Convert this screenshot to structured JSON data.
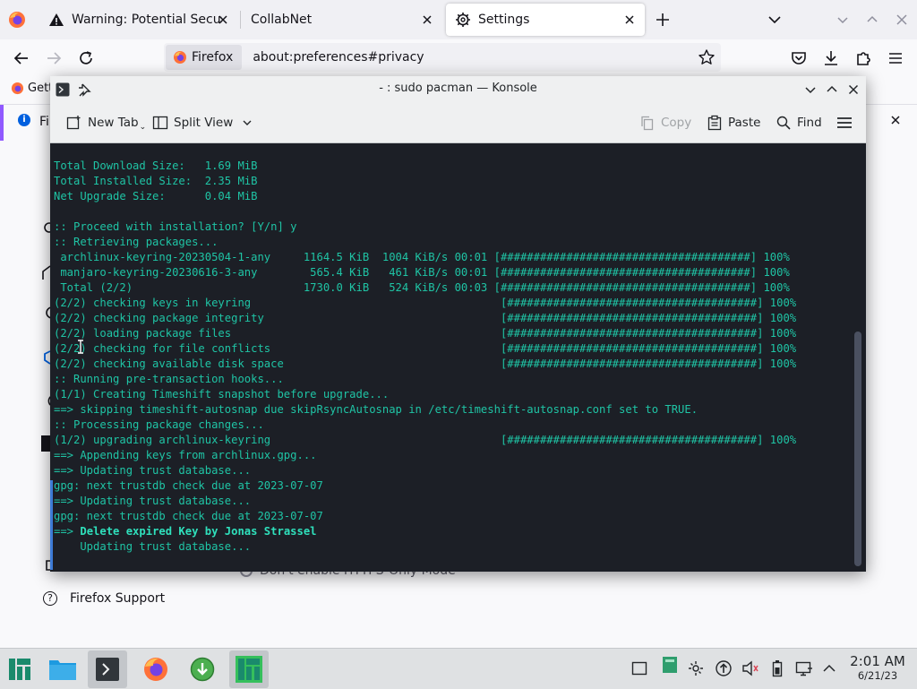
{
  "browser": {
    "tabs": [
      {
        "title": "Warning: Potential Security Risk Ahead",
        "icon": "warning-icon",
        "active": false
      },
      {
        "title": "CollabNet",
        "icon": "",
        "active": false
      },
      {
        "title": "Settings",
        "icon": "gear-icon",
        "active": true
      }
    ],
    "identity_label": "Firefox",
    "url": "about:preferences#privacy",
    "bookmark_label": "Getti",
    "notification_text": "Fi"
  },
  "page": {
    "https_option": "Don't enable HTTPS-Only Mode",
    "support_link": "Firefox Support"
  },
  "konsole": {
    "title": "- : sudo pacman — Konsole",
    "toolbar": {
      "new_tab": "New Tab",
      "split_view": "Split View",
      "copy": "Copy",
      "paste": "Paste",
      "find": "Find"
    },
    "terminal_lines": [
      {
        "text": "Total Download Size:   1.69 MiB"
      },
      {
        "text": "Total Installed Size:  2.35 MiB"
      },
      {
        "text": "Net Upgrade Size:      0.04 MiB"
      },
      {
        "text": ""
      },
      {
        "text": ":: Proceed with installation? [Y/n] y"
      },
      {
        "text": ":: Retrieving packages..."
      },
      {
        "text": " archlinux-keyring-20230504-1-any     1164.5 KiB  1004 KiB/s 00:01 [######################################] 100%"
      },
      {
        "text": " manjaro-keyring-20230616-3-any        565.4 KiB   461 KiB/s 00:01 [######################################] 100%"
      },
      {
        "text": " Total (2/2)                          1730.0 KiB   524 KiB/s 00:03 [######################################] 100%"
      },
      {
        "text": "(2/2) checking keys in keyring                                      [######################################] 100%"
      },
      {
        "text": "(2/2) checking package integrity                                    [######################################] 100%"
      },
      {
        "text": "(2/2) loading package files                                         [######################################] 100%"
      },
      {
        "text": "(2/2) checking for file conflicts                                   [######################################] 100%"
      },
      {
        "text": "(2/2) checking available disk space                                 [######################################] 100%"
      },
      {
        "text": ":: Running pre-transaction hooks..."
      },
      {
        "text": "(1/1) Creating Timeshift snapshot before upgrade..."
      },
      {
        "text": "==> skipping timeshift-autosnap due skipRsyncAutosnap in /etc/timeshift-autosnap.conf set to TRUE."
      },
      {
        "text": ":: Processing package changes..."
      },
      {
        "text": "(1/2) upgrading archlinux-keyring                                   [######################################] 100%"
      },
      {
        "text": "==> Appending keys from archlinux.gpg..."
      },
      {
        "text": "==> Updating trust database..."
      },
      {
        "text": "gpg: next trustdb check due at 2023-07-07"
      },
      {
        "text": "==> Updating trust database..."
      },
      {
        "text": "gpg: next trustdb check due at 2023-07-07"
      },
      {
        "prefix": "==> ",
        "bold": "Delete expired Key by Jonas Strassel"
      },
      {
        "text": "    Updating trust database..."
      }
    ]
  },
  "taskbar": {
    "apps": [
      "manjaro-menu-icon",
      "file-manager-icon",
      "konsole-icon",
      "firefox-icon",
      "download-icon",
      "manjaro-app-icon"
    ],
    "clock_time": "2:01 AM",
    "clock_date": "6/21/23"
  },
  "colors": {
    "terminal_bg": "#1c1f26",
    "terminal_fg": "#1fc4a5",
    "taskbar_bg": "#dfe1e3",
    "accent": "#9059ff"
  }
}
